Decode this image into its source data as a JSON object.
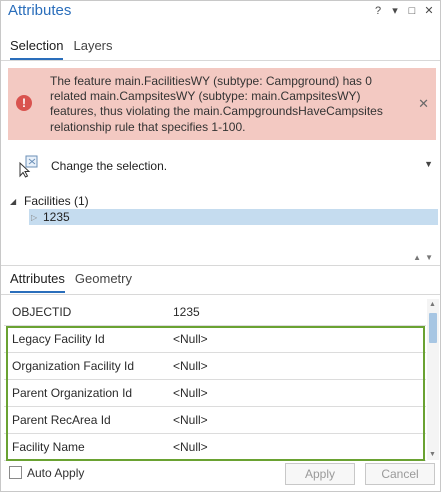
{
  "window": {
    "title": "Attributes",
    "controls": {
      "help": "?",
      "options": "▾",
      "restore": "□",
      "close": "✕"
    }
  },
  "top_tabs": [
    {
      "label": "Selection",
      "active": true
    },
    {
      "label": "Layers",
      "active": false
    }
  ],
  "error_banner": {
    "icon": "error-icon",
    "message": "The feature main.FacilitiesWY (subtype: Campground) has 0 related main.CampsitesWY (subtype: main.CampsitesWY) features, thus violating the main.CampgroundsHaveCampsites relationship rule that specifies 1-100.",
    "close": "✕",
    "colors": {
      "background": "#f3c9c2",
      "icon": "#d9534f"
    }
  },
  "change_selection": {
    "label": "Change the selection.",
    "icon": "change-selection-icon",
    "dropdown": "▼"
  },
  "tree": {
    "root": {
      "caret": "◢",
      "label": "Facilities (1)"
    },
    "children": [
      {
        "caret": "▷",
        "label": "1235",
        "selected": true
      }
    ]
  },
  "splitter": {
    "up": "▲",
    "down": "▼"
  },
  "bottom_tabs": [
    {
      "label": "Attributes",
      "active": true
    },
    {
      "label": "Geometry",
      "active": false
    }
  ],
  "attributes": [
    {
      "name": "OBJECTID",
      "value": "1235"
    },
    {
      "name": "Legacy Facility Id",
      "value": "<Null>"
    },
    {
      "name": "Organization Facility Id",
      "value": "<Null>"
    },
    {
      "name": "Parent Organization Id",
      "value": "<Null>"
    },
    {
      "name": "Parent RecArea Id",
      "value": "<Null>"
    },
    {
      "name": "Facility Name",
      "value": "<Null>"
    }
  ],
  "scrollbar": {
    "up": "▲",
    "down": "▼"
  },
  "footer": {
    "auto_apply_label": "Auto Apply",
    "auto_apply_checked": false,
    "apply_label": "Apply",
    "cancel_label": "Cancel"
  },
  "colors": {
    "accent": "#2a6ebb",
    "highlight_border": "#6aa232",
    "selected_row": "#c5dcef"
  }
}
